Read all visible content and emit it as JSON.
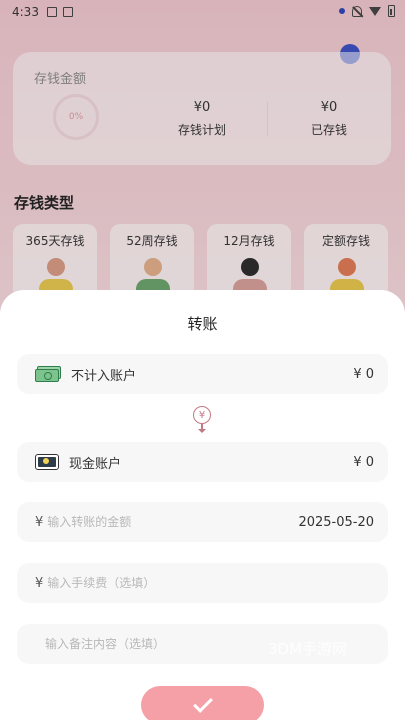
{
  "status_bar": {
    "time": "4:33"
  },
  "summary": {
    "title": "存钱金额",
    "progress": "0%",
    "plan_value": "¥0",
    "plan_label": "存钱计划",
    "saved_value": "¥0",
    "saved_label": "已存钱"
  },
  "types": {
    "title": "存钱类型",
    "items": [
      "365天存钱",
      "52周存钱",
      "12月存钱",
      "定额存钱"
    ]
  },
  "sheet": {
    "title": "转账",
    "from_account": {
      "label": "不计入账户",
      "amount": "¥ 0"
    },
    "to_account": {
      "label": "现金账户",
      "amount": "¥ 0"
    },
    "amount_input": {
      "prefix": "¥",
      "placeholder": "输入转账的金额",
      "date": "2025-05-20"
    },
    "fee_input": {
      "prefix": "¥",
      "placeholder": "输入手续费（选填）"
    },
    "note_input": {
      "placeholder": "输入备注内容（选填）"
    },
    "transfer_symbol": "¥"
  },
  "watermark": "3DM手游网",
  "colors": {
    "accent": "#f4a0a6",
    "background": "#f6d6db",
    "status_dot": "#2d45b8"
  }
}
